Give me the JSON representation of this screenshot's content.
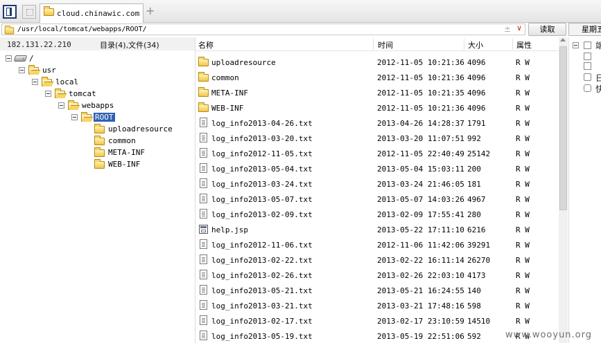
{
  "tabs": {
    "active_label": "cloud.chinawic.com",
    "add_symbol": "+"
  },
  "address": {
    "path": "/usr/local/tomcat/webapps/ROOT/",
    "plus_minus": "±",
    "chevron": "∨",
    "read_label": "读取",
    "week_label": "星期五"
  },
  "tree": {
    "ip": "182.131.22.210",
    "summary": "目录(4),文件(34)",
    "nodes": {
      "root": "/",
      "usr": "usr",
      "local": "local",
      "tomcat": "tomcat",
      "webapps": "webapps",
      "ROOT": "ROOT",
      "uploadresource": "uploadresource",
      "common": "common",
      "META-INF": "META-INF",
      "WEB-INF": "WEB-INF"
    }
  },
  "list": {
    "headers": {
      "name": "名称",
      "time": "时间",
      "size": "大小",
      "attr": "属性"
    },
    "rows": [
      {
        "type": "folder",
        "name": "uploadresource",
        "time": "2012-11-05 10:21:36",
        "size": "4096",
        "attr": "R W"
      },
      {
        "type": "folder",
        "name": "common",
        "time": "2012-11-05 10:21:36",
        "size": "4096",
        "attr": "R W"
      },
      {
        "type": "folder",
        "name": "META-INF",
        "time": "2012-11-05 10:21:35",
        "size": "4096",
        "attr": "R W"
      },
      {
        "type": "folder",
        "name": "WEB-INF",
        "time": "2012-11-05 10:21:36",
        "size": "4096",
        "attr": "R W"
      },
      {
        "type": "txt",
        "name": "log_info2013-04-26.txt",
        "time": "2013-04-26 14:28:37",
        "size": "1791",
        "attr": "R W"
      },
      {
        "type": "txt",
        "name": "log_info2013-03-20.txt",
        "time": "2013-03-20 11:07:51",
        "size": "992",
        "attr": "R W"
      },
      {
        "type": "txt",
        "name": "log_info2012-11-05.txt",
        "time": "2012-11-05 22:40:49",
        "size": "25142",
        "attr": "R W"
      },
      {
        "type": "txt",
        "name": "log_info2013-05-04.txt",
        "time": "2013-05-04 15:03:11",
        "size": "200",
        "attr": "R W"
      },
      {
        "type": "txt",
        "name": "log_info2013-03-24.txt",
        "time": "2013-03-24 21:46:05",
        "size": "181",
        "attr": "R W"
      },
      {
        "type": "txt",
        "name": "log_info2013-05-07.txt",
        "time": "2013-05-07 14:03:26",
        "size": "4967",
        "attr": "R W"
      },
      {
        "type": "txt",
        "name": "log_info2013-02-09.txt",
        "time": "2013-02-09 17:55:41",
        "size": "280",
        "attr": "R W"
      },
      {
        "type": "jsp",
        "name": "help.jsp",
        "time": "2013-05-22 17:11:10",
        "size": "6216",
        "attr": "R W"
      },
      {
        "type": "txt",
        "name": "log_info2012-11-06.txt",
        "time": "2012-11-06 11:42:06",
        "size": "39291",
        "attr": "R W"
      },
      {
        "type": "txt",
        "name": "log_info2013-02-22.txt",
        "time": "2013-02-22 16:11:14",
        "size": "26270",
        "attr": "R W"
      },
      {
        "type": "txt",
        "name": "log_info2013-02-26.txt",
        "time": "2013-02-26 22:03:10",
        "size": "4173",
        "attr": "R W"
      },
      {
        "type": "txt",
        "name": "log_info2013-05-21.txt",
        "time": "2013-05-21 16:24:55",
        "size": "140",
        "attr": "R W"
      },
      {
        "type": "txt",
        "name": "log_info2013-03-21.txt",
        "time": "2013-03-21 17:48:16",
        "size": "598",
        "attr": "R W"
      },
      {
        "type": "txt",
        "name": "log_info2013-02-17.txt",
        "time": "2013-02-17 23:10:59",
        "size": "14510",
        "attr": "R W"
      },
      {
        "type": "txt",
        "name": "log_info2013-05-19.txt",
        "time": "2013-05-19 22:51:06",
        "size": "592",
        "attr": "R W"
      }
    ]
  },
  "side": {
    "item1": "端",
    "item2": "日",
    "item3": "快"
  },
  "watermark": "www.wooyun.org"
}
